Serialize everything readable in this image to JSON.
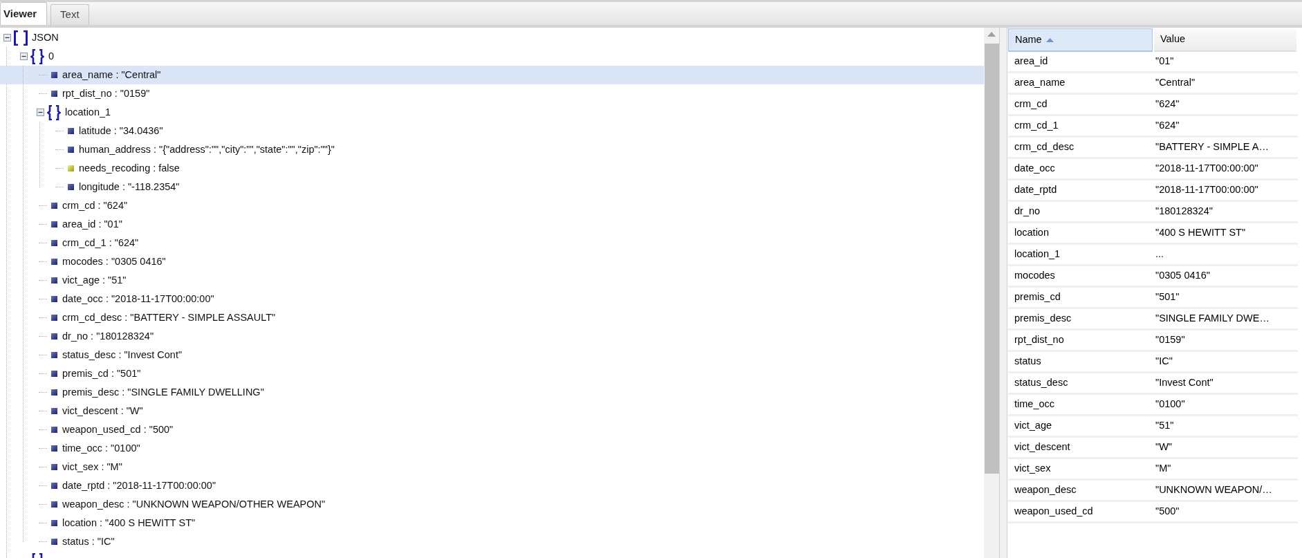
{
  "tabs": [
    {
      "label": "Viewer",
      "selected": true
    },
    {
      "label": "Text",
      "selected": false
    }
  ],
  "tree": [
    {
      "kind": "array",
      "text": "JSON",
      "expanded": true,
      "selected": false,
      "children": [
        {
          "kind": "object",
          "text": "0",
          "expanded": true,
          "selected": false,
          "children": [
            {
              "kind": "string",
              "text": "area_name : \"Central\"",
              "selected": true
            },
            {
              "kind": "string",
              "text": "rpt_dist_no : \"0159\"",
              "selected": false
            },
            {
              "kind": "object",
              "text": "location_1",
              "expanded": true,
              "selected": false,
              "children": [
                {
                  "kind": "string",
                  "text": "latitude : \"34.0436\"",
                  "selected": false
                },
                {
                  "kind": "string",
                  "text": "human_address : \"{\"address\":\"\",\"city\":\"\",\"state\":\"\",\"zip\":\"\"}\"",
                  "selected": false
                },
                {
                  "kind": "boolean",
                  "text": "needs_recoding : false",
                  "selected": false
                },
                {
                  "kind": "string",
                  "text": "longitude : \"-118.2354\"",
                  "selected": false
                }
              ]
            },
            {
              "kind": "string",
              "text": "crm_cd : \"624\"",
              "selected": false
            },
            {
              "kind": "string",
              "text": "area_id : \"01\"",
              "selected": false
            },
            {
              "kind": "string",
              "text": "crm_cd_1 : \"624\"",
              "selected": false
            },
            {
              "kind": "string",
              "text": "mocodes : \"0305 0416\"",
              "selected": false
            },
            {
              "kind": "string",
              "text": "vict_age : \"51\"",
              "selected": false
            },
            {
              "kind": "string",
              "text": "date_occ : \"2018-11-17T00:00:00\"",
              "selected": false
            },
            {
              "kind": "string",
              "text": "crm_cd_desc : \"BATTERY - SIMPLE ASSAULT\"",
              "selected": false
            },
            {
              "kind": "string",
              "text": "dr_no : \"180128324\"",
              "selected": false
            },
            {
              "kind": "string",
              "text": "status_desc : \"Invest Cont\"",
              "selected": false
            },
            {
              "kind": "string",
              "text": "premis_cd : \"501\"",
              "selected": false
            },
            {
              "kind": "string",
              "text": "premis_desc : \"SINGLE FAMILY DWELLING\"",
              "selected": false
            },
            {
              "kind": "string",
              "text": "vict_descent : \"W\"",
              "selected": false
            },
            {
              "kind": "string",
              "text": "weapon_used_cd : \"500\"",
              "selected": false
            },
            {
              "kind": "string",
              "text": "time_occ : \"0100\"",
              "selected": false
            },
            {
              "kind": "string",
              "text": "vict_sex : \"M\"",
              "selected": false
            },
            {
              "kind": "string",
              "text": "date_rptd : \"2018-11-17T00:00:00\"",
              "selected": false
            },
            {
              "kind": "string",
              "text": "weapon_desc : \"UNKNOWN WEAPON/OTHER WEAPON\"",
              "selected": false
            },
            {
              "kind": "string",
              "text": "location : \"400 S HEWITT ST\"",
              "selected": false
            },
            {
              "kind": "string",
              "text": "status : \"IC\"",
              "selected": false
            }
          ]
        },
        {
          "kind": "object",
          "selected": false
        }
      ]
    }
  ],
  "table": {
    "columns": [
      {
        "label": "Name",
        "sorted": true
      },
      {
        "label": "Value",
        "sorted": false
      }
    ],
    "rows": [
      [
        "area_id",
        "\"01\""
      ],
      [
        "area_name",
        "\"Central\""
      ],
      [
        "crm_cd",
        "\"624\""
      ],
      [
        "crm_cd_1",
        "\"624\""
      ],
      [
        "crm_cd_desc",
        "\"BATTERY - SIMPLE A…"
      ],
      [
        "date_occ",
        "\"2018-11-17T00:00:00\""
      ],
      [
        "date_rptd",
        "\"2018-11-17T00:00:00\""
      ],
      [
        "dr_no",
        "\"180128324\""
      ],
      [
        "location",
        "\"400 S HEWITT ST\""
      ],
      [
        "location_1",
        "..."
      ],
      [
        "mocodes",
        "\"0305 0416\""
      ],
      [
        "premis_cd",
        "\"501\""
      ],
      [
        "premis_desc",
        "\"SINGLE FAMILY DWE…"
      ],
      [
        "rpt_dist_no",
        "\"0159\""
      ],
      [
        "status",
        "\"IC\""
      ],
      [
        "status_desc",
        "\"Invest Cont\""
      ],
      [
        "time_occ",
        "\"0100\""
      ],
      [
        "vict_age",
        "\"51\""
      ],
      [
        "vict_descent",
        "\"W\""
      ],
      [
        "vict_sex",
        "\"M\""
      ],
      [
        "weapon_desc",
        "\"UNKNOWN WEAPON/…"
      ],
      [
        "weapon_used_cd",
        "\"500\""
      ]
    ]
  }
}
